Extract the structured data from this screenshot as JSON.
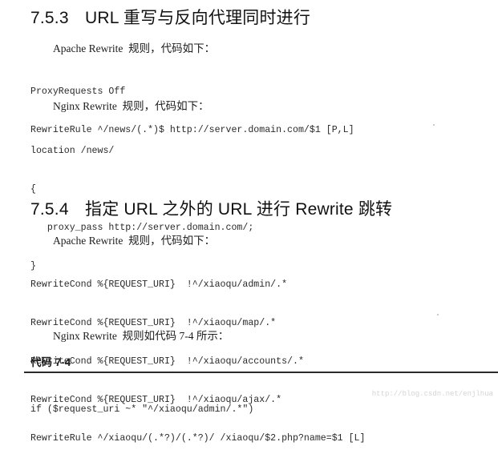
{
  "sections": [
    {
      "number": "7.5.3",
      "title": "URL 重写与反向代理同时进行",
      "apache_intro": "Apache Rewrite  规则，代码如下：",
      "apache_code": [
        "ProxyRequests Off",
        "RewriteRule ^/news/(.*)$ http://server.domain.com/$1 [P,L]"
      ],
      "nginx_intro": "Nginx Rewrite  规则，代码如下：",
      "nginx_code": [
        "location /news/",
        "{",
        "   proxy_pass http://server.domain.com/;",
        "}"
      ]
    },
    {
      "number": "7.5.4",
      "title": "指定 URL 之外的 URL 进行 Rewrite 跳转",
      "apache_intro": "Apache Rewrite  规则，代码如下：",
      "apache_code": [
        "RewriteCond %{REQUEST_URI}  !^/xiaoqu/admin/.*",
        "RewriteCond %{REQUEST_URI}  !^/xiaoqu/map/.*",
        "RewriteCond %{REQUEST_URI}  !^/xiaoqu/accounts/.*",
        "RewriteCond %{REQUEST_URI}  !^/xiaoqu/ajax/.*",
        "RewriteRule ^/xiaoqu/(.*?)/(.*?)/ /xiaoqu/$2.php?name=$1 [L]"
      ],
      "nginx_intro": "Nginx Rewrite  规则如代码 7-4 所示：",
      "listing_caption": "代码 7-4",
      "nginx_code": [
        "if ($request_uri ~* \"^/xiaoqu/admin/.*\")"
      ]
    }
  ],
  "watermark": "http://blog.csdn.net/enjlhua"
}
